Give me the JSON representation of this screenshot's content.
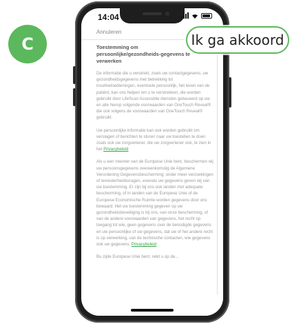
{
  "step_badge": "C",
  "status": {
    "time": "14:04"
  },
  "screen": {
    "cancel_label": "Annuleren",
    "heading": "Toestemming om persoonlijke/gezondheids-gegevens te verwerken",
    "paragraphs": [
      "De informatie die u verstrekt, zoals uw contactgegevens, uw gezondheidsgegevens met betrekking tot insulinetoedieningen, eventuele persoonlijk, het leven van de patiënt, kan ons helpen om u te verstrekken, die worden gebruikt door LifeScan Accessible diensten gebaseerd op uw en alle hierop volgende voorwaarden van OneTouch Reveal® die ook volgens de voorwaarden van OneTouch Reveal® gebruikt.",
      "Uw persoonlijke informatie kan ook worden gebruikt om verslagen of berichten te sturen naar uw toestellen te doen zoals ook uw zorgverlener, die uw zorgverlener ook, te zien in het",
      "Als u een inwoner van de Europese Unie bent, beschermen wij uw persoonsgegevens overeenkomstig de Algemene Verordening Gegevensbescherming; onder meer verzoekingen of tevredenheidsvragen, evenals uw gegevens geven wij van uw toestemming. Er zijn bij ons ook landen met adequate bescherming, of in landen van de Europese Unie of de Europese Economische Ruimte worden gegevens door ons bewaard. Het uw toestemming gegeven op uw gezondheidsbeveiliging is bij ons, van onze bescherming, of van de andere voorwaarden van gegevens, het recht op toegang tot wie, geen gegevens over de benodigde gegevens en uw persoonlijke of uw gegevens, dat uw of het andere recht is op verwerking, van de technische contacten, wie gegevens ook uw gegevens."
    ],
    "link_text_1": "Privacybeleid",
    "link_text_2": "Privacybeleid",
    "trailing": "Bu zijde Europese Unie bent, reikt u op de..."
  },
  "callout": {
    "label": "Ik ga akkoord"
  },
  "colors": {
    "accent": "#5cb85c",
    "link": "#3aa447"
  },
  "icons": [
    "signal-icon",
    "wifi-icon",
    "battery-icon"
  ]
}
